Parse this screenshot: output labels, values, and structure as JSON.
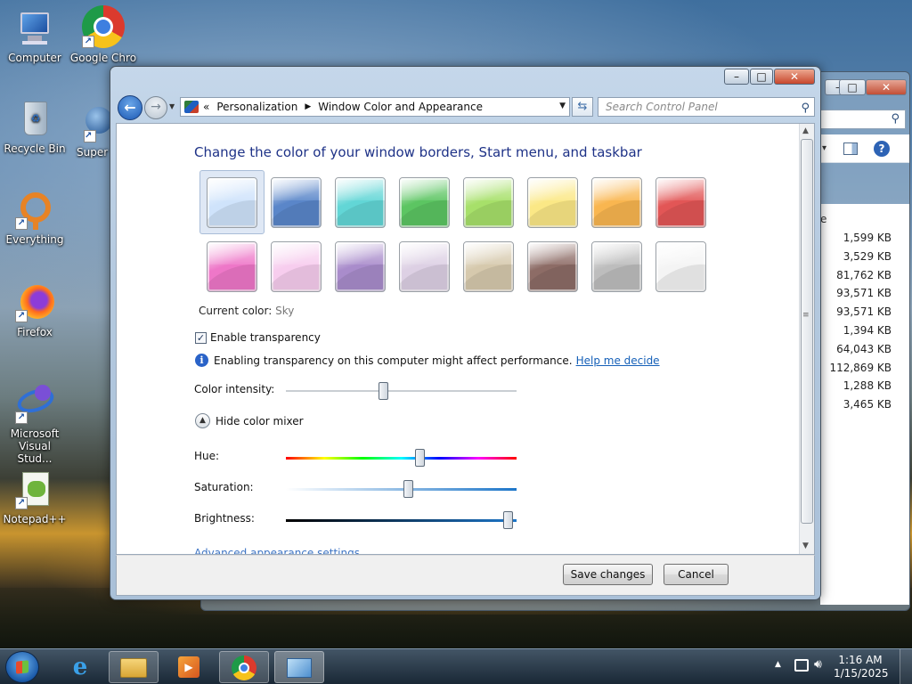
{
  "desktop": {
    "icons": [
      {
        "label": "Computer",
        "icon": "computer-icon"
      },
      {
        "label": "Google Chro",
        "icon": "chrome-icon"
      },
      {
        "label": "Recycle Bin",
        "icon": "recycle-bin-icon"
      },
      {
        "label": "Super",
        "icon": "app-icon"
      },
      {
        "label": "Everything",
        "icon": "everything-icon"
      },
      {
        "label": "Firefox",
        "icon": "firefox-icon"
      },
      {
        "label": "Microsoft Visual Stud...",
        "icon": "visual-studio-icon"
      },
      {
        "label": "Notepad++",
        "icon": "notepadpp-icon"
      }
    ]
  },
  "background_window": {
    "sizes": [
      "1,599 KB",
      "3,529 KB",
      "81,762 KB",
      "93,571 KB",
      "93,571 KB",
      "1,394 KB",
      "64,043 KB",
      "112,869 KB",
      "1,288 KB",
      "3,465 KB"
    ],
    "col_fragment": "e",
    "help_glyph": "?",
    "caption": {
      "minimize": "–",
      "maximize": "□",
      "close": "✕"
    }
  },
  "window": {
    "caption": {
      "minimize": "–",
      "maximize": "□",
      "close": "✕"
    },
    "breadcrumb": {
      "prefix": "«",
      "items": [
        "Personalization",
        "Window Color and Appearance"
      ]
    },
    "search_placeholder": "Search Control Panel",
    "heading": "Change the color of your window borders, Start menu, and taskbar",
    "swatches": [
      {
        "name": "sky",
        "color": "#cfe3fb"
      },
      {
        "name": "twilight",
        "color": "#5a86c9"
      },
      {
        "name": "sea",
        "color": "#62d6d6"
      },
      {
        "name": "leaf",
        "color": "#5cc562"
      },
      {
        "name": "lime",
        "color": "#a7e06a"
      },
      {
        "name": "sun",
        "color": "#fbe886"
      },
      {
        "name": "pumpkin",
        "color": "#f9b650"
      },
      {
        "name": "ruby",
        "color": "#e25656"
      },
      {
        "name": "fuchsia",
        "color": "#ee77c8"
      },
      {
        "name": "blush",
        "color": "#f7cdee"
      },
      {
        "name": "violet",
        "color": "#a98ccb"
      },
      {
        "name": "lavender",
        "color": "#ddd0e4"
      },
      {
        "name": "taupe",
        "color": "#d6c9ad"
      },
      {
        "name": "chocolate",
        "color": "#8d6c66"
      },
      {
        "name": "slate",
        "color": "#bdbdbd"
      },
      {
        "name": "frost",
        "color": "#f4f4f4"
      }
    ],
    "current_color_label": "Current color:",
    "current_color_value": "Sky",
    "enable_transparency": "Enable transparency",
    "transparency_checked": true,
    "info_text": "Enabling transparency on this computer might affect performance.",
    "help_link": "Help me decide",
    "color_intensity_label": "Color intensity:",
    "color_intensity": 0.42,
    "hide_mixer_label": "Hide color mixer",
    "hue_label": "Hue:",
    "hue": 0.58,
    "saturation_label": "Saturation:",
    "saturation": 0.53,
    "brightness_label": "Brightness:",
    "brightness": 0.96,
    "advanced_link": "Advanced appearance settings...",
    "save_button": "Save changes",
    "cancel_button": "Cancel"
  },
  "taskbar": {
    "time": "1:16 AM",
    "date": "1/15/2025",
    "items": [
      "internet-explorer-icon",
      "file-explorer-icon",
      "media-player-icon",
      "chrome-icon",
      "control-panel-icon"
    ]
  }
}
